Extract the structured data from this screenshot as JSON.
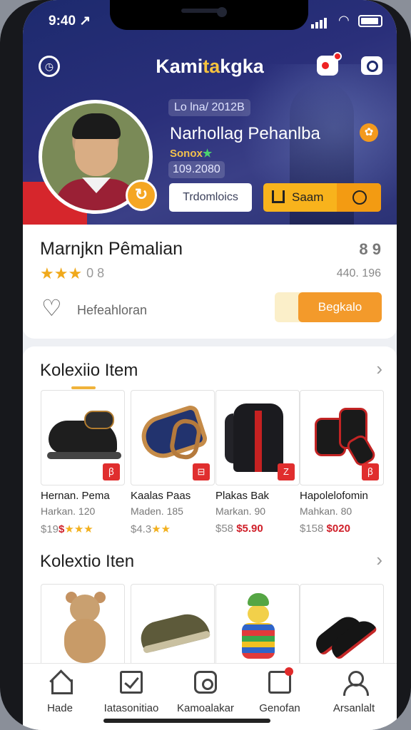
{
  "status": {
    "time": "9:40 ↗"
  },
  "header": {
    "title_main": "Kami",
    "title_highlight": "ta",
    "title_end": "kgka"
  },
  "profile": {
    "date": "Lo lna/ 2012B",
    "name": "Narhollag Pehanlba",
    "rank": "Sonox",
    "rank_star": "★",
    "score": "109.2080",
    "badge_icon": "refresh-icon",
    "btn_secondary": "Trdomloics",
    "btn_primary": "Saam"
  },
  "info": {
    "title": "Marnjkn Pêmalian",
    "score": "8 9",
    "stars": "★★★",
    "rating_num": "0 8",
    "count": "440. 196",
    "favorite_label": "Hefeahloran",
    "follow_label": "Begkalo"
  },
  "sections": [
    {
      "title": "Kolexiio Item",
      "items": [
        {
          "name": "Hernan. Pema",
          "sub": "Harkan. 120",
          "price_a": "$19",
          "price_b": "$",
          "stars": "★★★",
          "tag": "ꞵ"
        },
        {
          "name": "Kaalas Paas",
          "sub": "Maden. 185",
          "price_a": "$4.3",
          "price_b": "",
          "stars": "★★",
          "tag": "⊟"
        },
        {
          "name": "Plakas Bak",
          "sub": "Markan. 90",
          "price_a": "$58",
          "price_b": "$5.90",
          "stars": "",
          "tag": "Z"
        },
        {
          "name": "Hapolelofomin",
          "sub": "Mahkan. 80",
          "price_a": "$158",
          "price_b": "$020",
          "stars": "",
          "tag": "ꞵ"
        }
      ]
    },
    {
      "title": "Kolextio Iten",
      "items": [
        {
          "name": "",
          "sub": "",
          "price_a": "",
          "price_b": "",
          "stars": "",
          "tag": ""
        },
        {
          "name": "",
          "sub": "",
          "price_a": "",
          "price_b": "",
          "stars": "",
          "tag": ""
        },
        {
          "name": "",
          "sub": "",
          "price_a": "",
          "price_b": "",
          "stars": "",
          "tag": ""
        },
        {
          "name": "",
          "sub": "",
          "price_a": "",
          "price_b": "",
          "stars": "",
          "tag": ""
        }
      ]
    }
  ],
  "tabbar": [
    {
      "label": "Hade",
      "icon": "home-icon"
    },
    {
      "label": "Iatasonitiao",
      "icon": "checklist-icon"
    },
    {
      "label": "Kamoalakar",
      "icon": "camera-icon"
    },
    {
      "label": "Genofan",
      "icon": "chat-icon"
    },
    {
      "label": "Arsanlalt",
      "icon": "user-icon"
    }
  ],
  "colors": {
    "banner": "#1d2a6e",
    "accent": "#f8b31c",
    "follow": "#f39a2b",
    "price_red": "#d0202a"
  }
}
